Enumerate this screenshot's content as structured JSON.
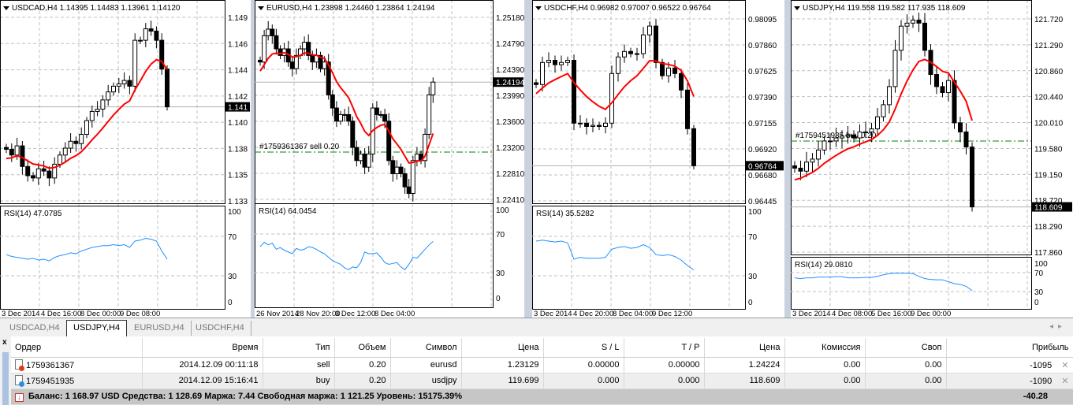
{
  "charts": [
    {
      "header": "USDCAD,H4  1.14395 1.14483 1.13961 1.14120",
      "ticks": [
        "1.149",
        "1.146",
        "1.144",
        "1.142",
        "1.140",
        "1.138",
        "1.135",
        "1.133"
      ],
      "tick_values": [
        1.149,
        1.133
      ],
      "current_price": "1.141",
      "current_value": 1.1412,
      "closes": [
        1.1375,
        1.137,
        1.1378,
        1.136,
        1.1352,
        1.135,
        1.1358,
        1.1356,
        1.135,
        1.1362,
        1.137,
        1.1376,
        1.1382,
        1.138,
        1.1388,
        1.14,
        1.1408,
        1.141,
        1.1418,
        1.1425,
        1.143,
        1.1432,
        1.1435,
        1.143,
        1.147,
        1.147,
        1.148,
        1.1478,
        1.147,
        1.1445,
        1.1412
      ],
      "rsi_label": "RSI(14) 47.0785",
      "rsi": [
        52,
        50,
        49,
        48,
        47,
        48,
        46,
        47,
        45,
        49,
        51,
        52,
        54,
        53,
        56,
        58,
        60,
        61,
        62,
        62,
        63,
        62,
        63,
        60,
        67,
        68,
        70,
        69,
        67,
        56,
        47
      ],
      "rsi_ticks": [
        "100",
        "70",
        "30",
        "0"
      ],
      "time_labels": [
        "3 Dec 2014",
        "4 Dec 16:00",
        "8 Dec 00:00",
        "9 Dec 08:00"
      ]
    },
    {
      "header": "EURUSD,H4  1.23898 1.24460 1.23864 1.24194",
      "ticks": [
        "1.25180",
        "1.24790",
        "1.24390",
        "1.23990",
        "1.23600",
        "1.23200",
        "1.22810",
        "1.22410"
      ],
      "tick_values": [
        1.2518,
        1.2241
      ],
      "current_price": "1.24194",
      "current_value": 1.24194,
      "order_line": {
        "label": "#1759361367 sell 0.20",
        "price": 1.23129
      },
      "closes": [
        1.245,
        1.249,
        1.25,
        1.249,
        1.247,
        1.246,
        1.247,
        1.245,
        1.244,
        1.246,
        1.247,
        1.248,
        1.246,
        1.245,
        1.246,
        1.244,
        1.245,
        1.24,
        1.238,
        1.236,
        1.237,
        1.237,
        1.236,
        1.232,
        1.23,
        1.231,
        1.229,
        1.231,
        1.238,
        1.237,
        1.237,
        1.236,
        1.23,
        1.228,
        1.229,
        1.228,
        1.226,
        1.225,
        1.23,
        1.231,
        1.23,
        1.234,
        1.24,
        1.24194
      ],
      "rsi_label": "RSI(14) 64.0454",
      "rsi": [
        58,
        63,
        60,
        62,
        55,
        57,
        54,
        52,
        50,
        56,
        54,
        55,
        58,
        57,
        55,
        52,
        50,
        46,
        42,
        40,
        38,
        34,
        32,
        35,
        34,
        40,
        52,
        50,
        50,
        51,
        46,
        40,
        38,
        39,
        40,
        35,
        32,
        38,
        46,
        45,
        50,
        55,
        60,
        64
      ],
      "rsi_ticks": [
        "100",
        "70",
        "30",
        "0"
      ],
      "time_labels": [
        "26 Nov 2014",
        "28 Nov 20:00",
        "3 Dec 12:00",
        "8 Dec 04:00"
      ]
    },
    {
      "header": "USDCHF,H4  0.96982 0.97007 0.96522 0.96764",
      "ticks": [
        "0.98095",
        "0.97860",
        "0.97625",
        "0.97390",
        "0.97155",
        "0.96920",
        "0.96680",
        "0.96445"
      ],
      "tick_values": [
        0.98095,
        0.96445
      ],
      "current_price": "0.96764",
      "current_value": 0.96764,
      "closes": [
        0.975,
        0.977,
        0.9772,
        0.9768,
        0.977,
        0.9772,
        0.9715,
        0.9715,
        0.9712,
        0.9713,
        0.9712,
        0.9715,
        0.976,
        0.9775,
        0.978,
        0.9778,
        0.9778,
        0.9795,
        0.9803,
        0.977,
        0.9758,
        0.9765,
        0.976,
        0.9745,
        0.971,
        0.96764
      ],
      "rsi_label": "RSI(14) 35.5282",
      "rsi": [
        67,
        68,
        67,
        66,
        67,
        65,
        47,
        49,
        48,
        48,
        48,
        49,
        58,
        60,
        61,
        59,
        60,
        63,
        60,
        52,
        51,
        52,
        50,
        46,
        40,
        35
      ],
      "rsi_ticks": [
        "100",
        "70",
        "30",
        "0"
      ],
      "time_labels": [
        "3 Dec 2014",
        "4 Dec 20:00",
        "8 Dec 04:00",
        "9 Dec 12:00"
      ]
    },
    {
      "header": "USDJPY,H4  119.558 119.582 117.935 118.609",
      "ticks": [
        "121.720",
        "121.290",
        "120.860",
        "120.440",
        "120.010",
        "119.580",
        "119.150",
        "118.720",
        "118.290",
        "117.860"
      ],
      "tick_values": [
        121.72,
        117.86
      ],
      "current_price": "118.609",
      "current_value": 118.609,
      "order_line": {
        "label": "#1759451935 buy 0.20",
        "price": 119.699
      },
      "closes": [
        119.25,
        119.2,
        119.35,
        119.4,
        119.55,
        119.7,
        119.7,
        119.75,
        119.78,
        119.8,
        119.75,
        119.85,
        119.85,
        119.9,
        120.1,
        120.3,
        120.6,
        121.2,
        121.6,
        121.65,
        121.7,
        121.65,
        121.2,
        120.8,
        120.6,
        120.5,
        120.7,
        120.0,
        119.85,
        119.6,
        118.609
      ],
      "rsi_label": "RSI(14) 29.0810",
      "rsi": [
        62,
        60,
        62,
        62,
        64,
        64,
        64,
        65,
        65,
        62,
        62,
        62,
        63,
        63,
        66,
        70,
        73,
        74,
        74,
        74,
        73,
        66,
        60,
        58,
        57,
        57,
        52,
        47,
        45,
        40,
        29
      ],
      "rsi_ticks": [
        "100",
        "70",
        "30",
        "0"
      ],
      "time_labels": [
        "3 Dec 2014",
        "4 Dec 08:00",
        "5 Dec 16:00",
        "9 Dec 00:00"
      ]
    }
  ],
  "tabs": [
    "USDCAD,H4",
    "USDJPY,H4",
    "EURUSD,H4",
    "USDCHF,H4"
  ],
  "active_tab": "USDJPY,H4",
  "terminal": {
    "close_label": "x",
    "columns": [
      "Ордер",
      "Время",
      "Тип",
      "Объем",
      "Символ",
      "Цена",
      "S / L",
      "T / P",
      "Цена",
      "Комиссия",
      "Своп",
      "Прибыль"
    ],
    "rows": [
      {
        "order": "1759361367",
        "time": "2014.12.09 00:11:18",
        "type": "sell",
        "volume": "0.20",
        "symbol": "eurusd",
        "price": "1.23129",
        "sl": "0.00000",
        "tp": "0.00000",
        "cur_price": "1.24224",
        "commission": "0.00",
        "swap": "0.00",
        "profit": "-1095"
      },
      {
        "order": "1759451935",
        "time": "2014.12.09 15:16:41",
        "type": "buy",
        "volume": "0.20",
        "symbol": "usdjpy",
        "price": "119.699",
        "sl": "0.000",
        "tp": "0.000",
        "cur_price": "118.609",
        "commission": "0.00",
        "swap": "0.00",
        "profit": "-1090"
      }
    ],
    "summary": "Баланс: 1 168.97 USD  Средства: 1 128.69  Маржа: 7.44  Свободная маржа: 1 121.25  Уровень: 15175.39%",
    "total_profit": "-40.28"
  },
  "colors": {
    "ma": "#ff0000",
    "rsi": "#1e90ff",
    "order_line": "#008000",
    "sell_icon": "#e03c1c",
    "buy_icon": "#2a8fe0"
  }
}
